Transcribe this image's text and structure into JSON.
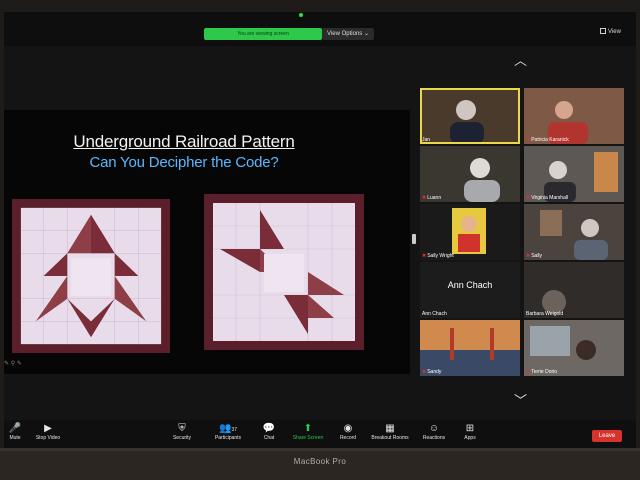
{
  "top_bar": {
    "viewing_banner": "You are viewing  screen",
    "view_options": "View Options ⌄",
    "view_label": "View"
  },
  "slide": {
    "title": "Underground Railroad Pattern",
    "subtitle": "Can You Decipher the Code?"
  },
  "gallery": {
    "participants": [
      {
        "name": "Jan",
        "active": true
      },
      {
        "name": "Patricia Karanick"
      },
      {
        "name": "Luann"
      },
      {
        "name": "Virginia Marshall"
      },
      {
        "name": "Sally Wright"
      },
      {
        "name": "Sally"
      },
      {
        "name": "Ann Chach",
        "display": "Ann Chach"
      },
      {
        "name": "Barbara Weigold"
      },
      {
        "name": "Sandy"
      },
      {
        "name": "Terrie Dorio"
      }
    ]
  },
  "toolbar": {
    "mute": "Mute",
    "stop_video": "Stop Video",
    "security": "Security",
    "participants": "Participants",
    "participants_count": "37",
    "chat": "Chat",
    "share_screen": "Share Screen",
    "record": "Record",
    "breakout_rooms": "Breakout Rooms",
    "reactions": "Reactions",
    "apps": "Apps",
    "leave": "Leave"
  },
  "laptop": {
    "brand_label": "MacBook Pro"
  },
  "colors": {
    "accent_green": "#2ec84a",
    "slide_subtitle_blue": "#5bb7ff",
    "leave_red": "#d6332c",
    "active_speaker_yellow": "#e8d84a",
    "quilt_border": "#5a1f2a",
    "quilt_light": "#e8dcea"
  }
}
